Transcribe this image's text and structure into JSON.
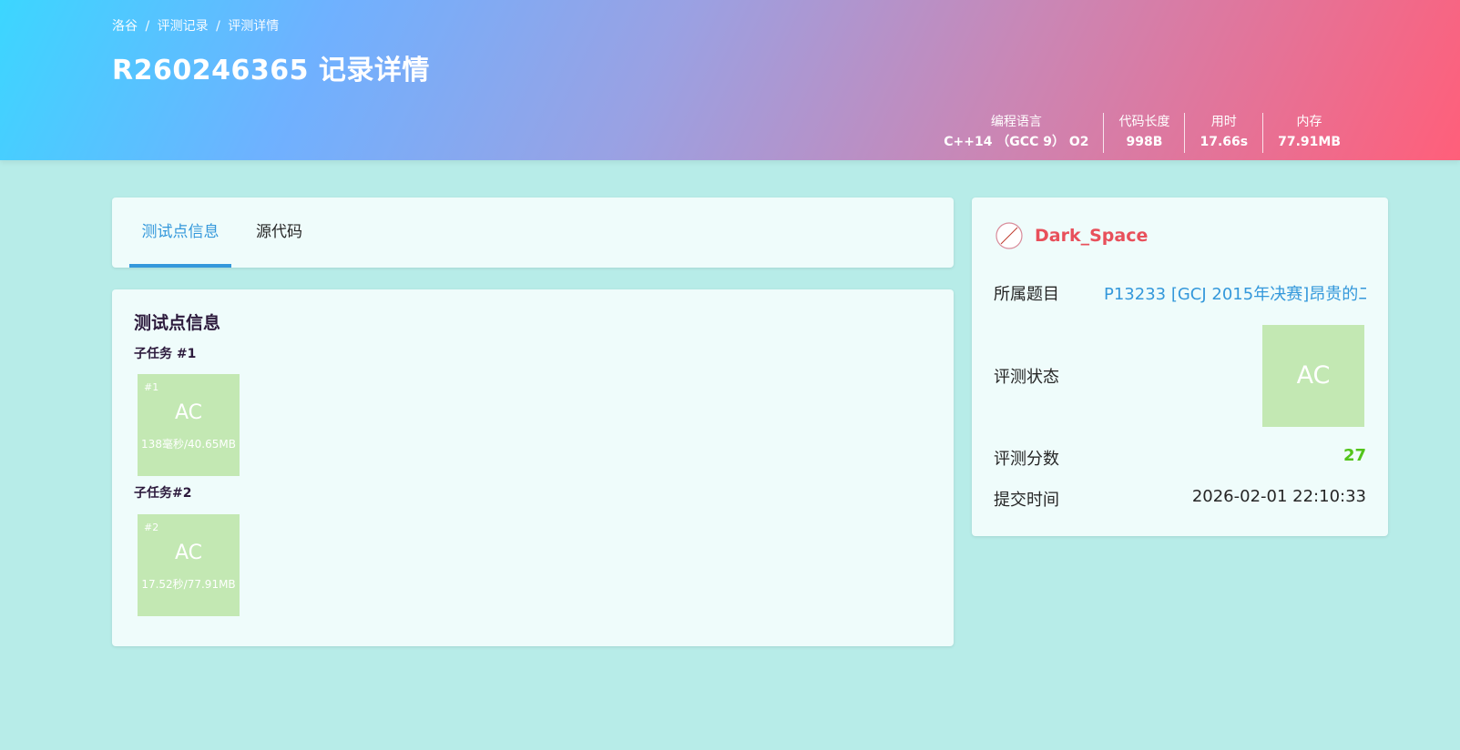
{
  "header": {
    "breadcrumb": [
      "洛谷",
      "/",
      "评测记录",
      "/",
      "评测详情"
    ],
    "title": "R260246365 记录详情",
    "stats": [
      {
        "label": "编程语言",
        "value": "C++14 （GCC 9） O2"
      },
      {
        "label": "代码长度",
        "value": "998B"
      },
      {
        "label": "用时",
        "value": "17.66s"
      },
      {
        "label": "内存",
        "value": "77.91MB"
      }
    ]
  },
  "tabs": {
    "test_info": "测试点信息",
    "source": "源代码"
  },
  "detail": {
    "title": "测试点信息",
    "subtasks": [
      {
        "title": "子任务 #1",
        "case": {
          "num": "#1",
          "status": "AC",
          "meta": "138毫秒/40.65MB"
        }
      },
      {
        "title": "子任务#2",
        "case": {
          "num": "#2",
          "status": "AC",
          "meta": "17.52秒/77.91MB"
        }
      }
    ]
  },
  "info": {
    "username": "Dark_Space",
    "problem_label": "所属题目",
    "problem_value": "P13233 [GCJ 2015年决赛]昂贵的二",
    "status_label": "评测状态",
    "status_value": "AC",
    "score_label": "评测分数",
    "score_value": "27",
    "time_label": "提交时间",
    "time_value": "2026-02-01 22:10:33"
  },
  "colors": {
    "accent": "#3498db",
    "ac_green": "#c3e8b3",
    "username": "#e8505b",
    "score": "#52c41a",
    "background": "#b7ece8"
  }
}
